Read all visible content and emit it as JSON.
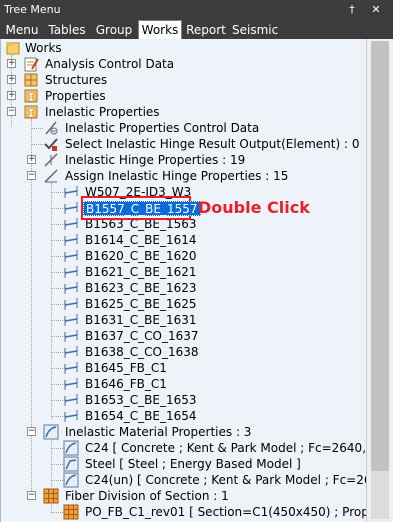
{
  "window": {
    "title": "Tree Menu",
    "pin_icon": "pin-icon",
    "close_icon": "close-icon"
  },
  "tabs": [
    {
      "label": "Menu"
    },
    {
      "label": "Tables"
    },
    {
      "label": "Group"
    },
    {
      "label": "Works",
      "active": true
    },
    {
      "label": "Report"
    },
    {
      "label": "Seismic"
    }
  ],
  "tree": {
    "root": "Works",
    "analysis_control": "Analysis Control Data",
    "structures": "Structures",
    "properties": "Properties",
    "inelastic_properties": "Inelastic Properties",
    "inelastic_control": "Inelastic Properties Control Data",
    "select_hinge_output": "Select Inelastic Hinge Result Output(Element) : 0",
    "hinge_properties": "Inelastic Hinge Properties : 19",
    "assign_hinge": "Assign Inelastic Hinge Properties : 15",
    "assign_items": [
      "W507_2E-ID3_W3",
      "B1557_C_BE_1557",
      "B1563_C_BE_1563",
      "B1614_C_BE_1614",
      "B1620_C_BE_1620",
      "B1621_C_BE_1621",
      "B1623_C_BE_1623",
      "B1625_C_BE_1625",
      "B1631_C_BE_1631",
      "B1637_C_CO_1637",
      "B1638_C_CO_1638",
      "B1645_FB_C1",
      "B1646_FB_C1",
      "B1653_C_BE_1653",
      "B1654_C_BE_1654"
    ],
    "selected_item": "B1557_C_BE_1557",
    "material_properties": "Inelastic Material Properties : 3",
    "material_items": [
      "C24 [ Concrete ; Kent & Park Model ; Fc=2640,...",
      "Steel [ Steel ; Energy Based Model ]",
      "C24(un) [ Concrete ; Kent & Park Model ; Fc=264..."
    ],
    "fiber_division": "Fiber Division of Section : 1",
    "fiber_items": [
      "PO_FB_C1_rev01 [ Section=C1(450x450) ; Prop1=0..."
    ]
  },
  "annotation": "Double Click",
  "colors": {
    "selection": "#0a6cd6",
    "annotation": "#e8202a",
    "tree_bg": "#eef3fa",
    "chrome": "#3c3c3c"
  }
}
